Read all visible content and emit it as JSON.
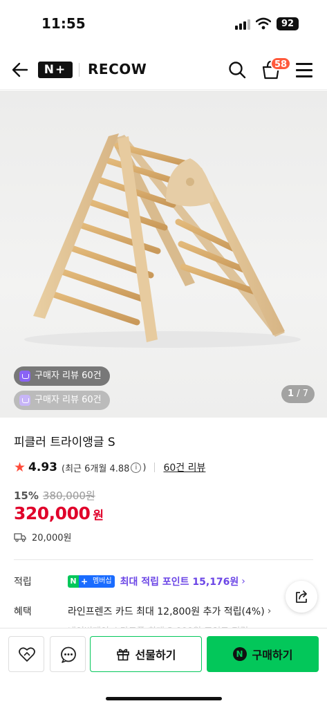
{
  "status": {
    "time": "11:55",
    "battery": "92"
  },
  "nav": {
    "logo": "N+",
    "store": "RECOW",
    "cart_count": "58"
  },
  "hero": {
    "review_chip_1": "구매자 리뷰 60건",
    "review_chip_2": "구매자 리뷰 60건",
    "page_current": "1",
    "page_total": "/ 7"
  },
  "product": {
    "title": "피클러 트라이앵글 S",
    "rating": "4.93",
    "rating_sub": "(최근 6개월 4.88",
    "rating_info": "i",
    "rating_close": ")",
    "review_count": "60건 리뷰",
    "discount_rate": "15%",
    "original_price": "380,000원",
    "price": "320,000",
    "price_unit": "원",
    "shipping": "20,000원"
  },
  "benefits": {
    "point_label": "적립",
    "membership_n": "N",
    "membership_plus": "+",
    "membership_text": "멤버십",
    "point_text": "최대 적립 포인트 15,176원",
    "benefit_label": "혜택",
    "benefit_text": "라인프렌즈 카드 최대 12,800원 추가 적립(4%)",
    "benefit_more": "네이버페이 스마트폰 최대 3,000원 포인트 적립",
    "chevron": "›"
  },
  "bottom": {
    "gift_label": "선물하기",
    "buy_label": "구매하기",
    "buy_icon": "N"
  },
  "icons": [
    "back-arrow-icon",
    "search-icon",
    "cart-icon",
    "hamburger-menu-icon",
    "star-icon",
    "truck-icon",
    "share-icon",
    "heart-icon",
    "chat-icon",
    "gift-icon"
  ],
  "colors": {
    "accent": "#03c75a",
    "price": "#e0002a",
    "badge": "#ff5a3c",
    "point": "#6b45e6"
  }
}
